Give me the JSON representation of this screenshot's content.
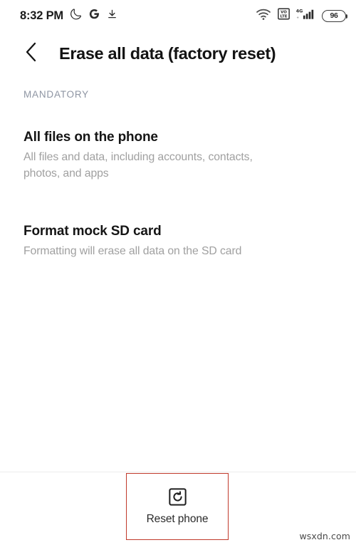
{
  "status_bar": {
    "clock": "8:32 PM",
    "left_icons": [
      {
        "name": "dark-mode-moon-icon",
        "glyph": "moon"
      },
      {
        "name": "google-g-icon",
        "glyph": "G"
      },
      {
        "name": "download-icon",
        "glyph": "download"
      }
    ],
    "right_icons": [
      {
        "name": "wifi-icon",
        "glyph": "wifi"
      },
      {
        "name": "volte-icon",
        "glyph": "VoLTE"
      },
      {
        "name": "cellular-signal-4g-icon",
        "glyph": "4G"
      }
    ],
    "battery_level": "96"
  },
  "header": {
    "back_icon": "chevron-left-icon",
    "title": "Erase all data (factory reset)"
  },
  "section": {
    "label": "MANDATORY"
  },
  "items": [
    {
      "title": "All files on the phone",
      "subtitle": "All files and data, including accounts, contacts, photos, and apps"
    },
    {
      "title": "Format mock SD card",
      "subtitle": "Formatting will erase all data on the SD card"
    }
  ],
  "bottom_bar": {
    "reset_icon": "reset-phone-icon",
    "reset_label": "Reset phone"
  },
  "annotation": {
    "color": "#c0392b",
    "target": "reset-phone-button"
  },
  "watermark": {
    "text": "wsxdn.com"
  },
  "colors": {
    "background": "#ffffff",
    "primary_text": "#131313",
    "secondary_text": "#a0a0a0",
    "section_label": "#8e95a3",
    "divider": "#ededed",
    "annotation": "#c0392b"
  }
}
